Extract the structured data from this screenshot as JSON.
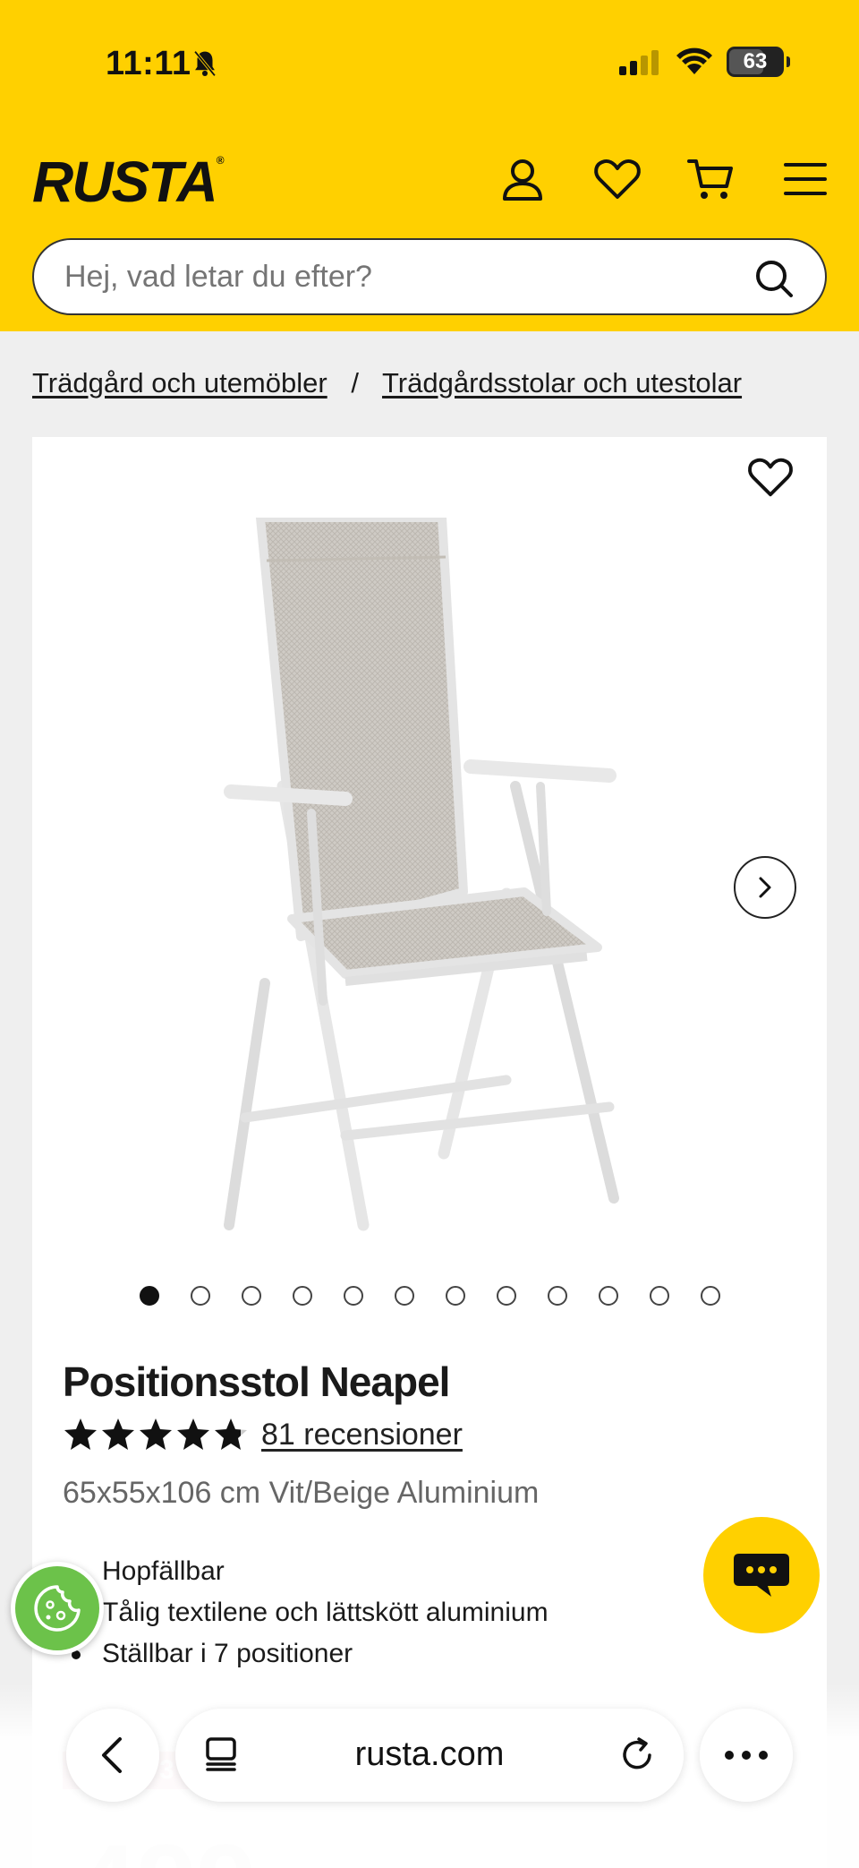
{
  "status_bar": {
    "time": "11:11",
    "battery": "63"
  },
  "header": {
    "logo": "RUSTA",
    "search": {
      "placeholder": "Hej, vad letar du efter?"
    }
  },
  "breadcrumb": {
    "items": [
      "Trädgård och utemöbler",
      "Trädgårdsstolar och utestolar"
    ],
    "separator": "/"
  },
  "product": {
    "title": "Positionsstol Neapel",
    "rating": 4.8,
    "reviews_label": "81 recensioner",
    "subtitle": "65x55x106 cm Vit/Beige Aluminium",
    "image_count": 12,
    "current_image": 1,
    "features": [
      "Hopfällbar",
      "Tålig textilene och lättskött aluminium",
      "Ställbar i 7 positioner"
    ],
    "badge": "3",
    "price_partial": "499"
  },
  "browser": {
    "url": "rusta.com"
  },
  "colors": {
    "brand": "#FFD000",
    "cookie": "#6cc24a",
    "badge": "#f4a5b5"
  }
}
